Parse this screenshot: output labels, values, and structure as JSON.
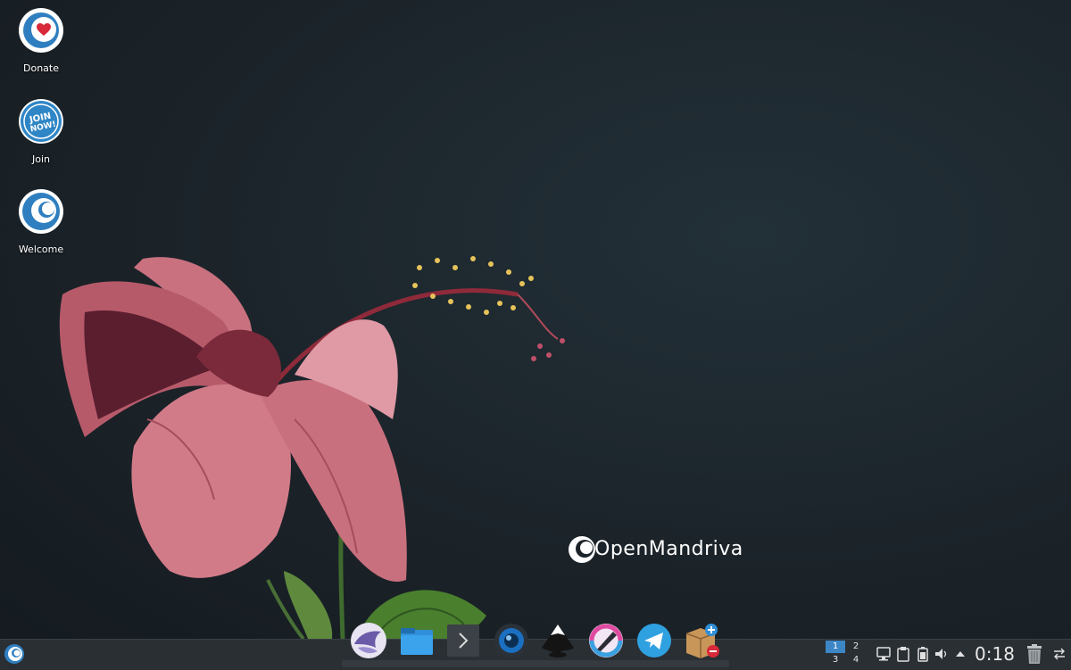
{
  "desktop": {
    "icons": [
      {
        "label": "Donate",
        "icon": "donate-heart-icon"
      },
      {
        "label": "Join",
        "icon": "join-now-icon"
      },
      {
        "label": "Welcome",
        "icon": "openmandriva-welcome-icon"
      }
    ],
    "brand": {
      "text": "OpenMandriva"
    }
  },
  "taskbar": {
    "launcher": {
      "icon": "openmandriva-logo-icon"
    },
    "dock_items": [
      {
        "name": "falkon-browser-icon"
      },
      {
        "name": "file-manager-icon"
      },
      {
        "name": "terminal-icon"
      },
      {
        "name": "camera-app-icon"
      },
      {
        "name": "inkscape-icon"
      },
      {
        "name": "krita-icon"
      },
      {
        "name": "telegram-icon"
      },
      {
        "name": "package-manager-icon"
      }
    ],
    "pager": {
      "desktops": [
        "1",
        "2",
        "3",
        "4"
      ],
      "active": "1"
    },
    "tray": {
      "icons": [
        "network-icon",
        "clipboard-icon",
        "battery-icon",
        "volume-icon",
        "expand-tray-icon"
      ]
    },
    "clock": "0:18",
    "trash": {
      "icon": "trash-icon"
    },
    "panel_settings": {
      "icon": "panel-settings-icon"
    }
  },
  "colors": {
    "background": "#1b2329",
    "panel": "#2a2f34",
    "accent": "#3d86c6"
  }
}
